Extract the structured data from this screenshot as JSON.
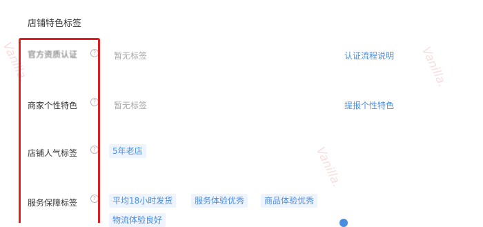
{
  "section_title": "店铺特色标签",
  "rows": [
    {
      "label": "官方资质认证",
      "empty_text": "暂无标签",
      "link": "认证流程说明"
    },
    {
      "label": "商家个性特色",
      "empty_text": "暂无标签",
      "link": "提报个性特色"
    },
    {
      "label": "店铺人气标签",
      "tags": [
        "5年老店"
      ]
    },
    {
      "label": "服务保障标签",
      "tags": [
        "平均18小时发货",
        "服务体验优秀",
        "商品体验优秀",
        "物流体验良好"
      ]
    }
  ],
  "help_icon": "?",
  "watermark": "Vanilla.",
  "colors": {
    "accent": "#4a8de0",
    "tag_bg": "#eef4fd",
    "highlight": "#e02020",
    "muted": "#a8a8a8"
  }
}
